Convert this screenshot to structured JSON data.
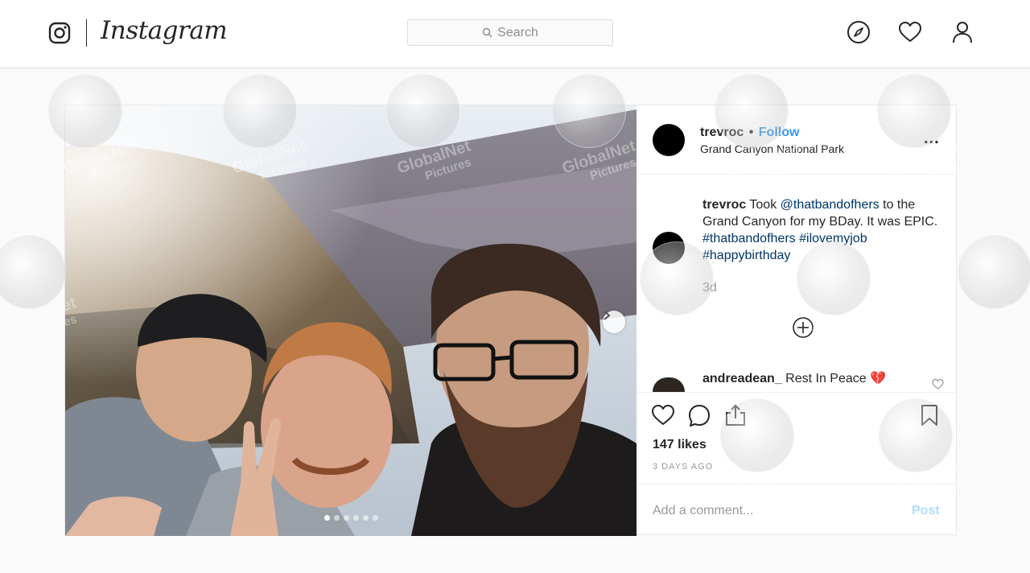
{
  "nav": {
    "wordmark": "Instagram",
    "search_placeholder": "Search"
  },
  "post": {
    "username": "trevroc",
    "separator": "•",
    "follow_label": "Follow",
    "location": "Grand Canyon National Park",
    "more_label": "...",
    "caption": {
      "username": "trevroc",
      "text_1": " Took ",
      "mention": "@thatbandofhers",
      "text_2": " to the Grand Canyon for my BDay. It was EPIC. ",
      "hashtags": [
        "#thatbandofhers",
        "#ilovemyjob",
        "#happybirthday"
      ]
    },
    "age": "3d",
    "comments": [
      {
        "username": "andreadean_",
        "text": "Rest In Peace 💔"
      }
    ],
    "likes": "147 likes",
    "timestamp": "3 DAYS AGO",
    "comment_placeholder": "Add a comment...",
    "post_label": "Post",
    "carousel": {
      "total": 6,
      "active": 1
    }
  },
  "watermark": {
    "brand": "GlobalNet",
    "sub": "Pictures"
  },
  "colors": {
    "link_blue": "#3897f0",
    "hashtag": "#003569",
    "muted": "#999999",
    "border": "#dbdbdb"
  }
}
